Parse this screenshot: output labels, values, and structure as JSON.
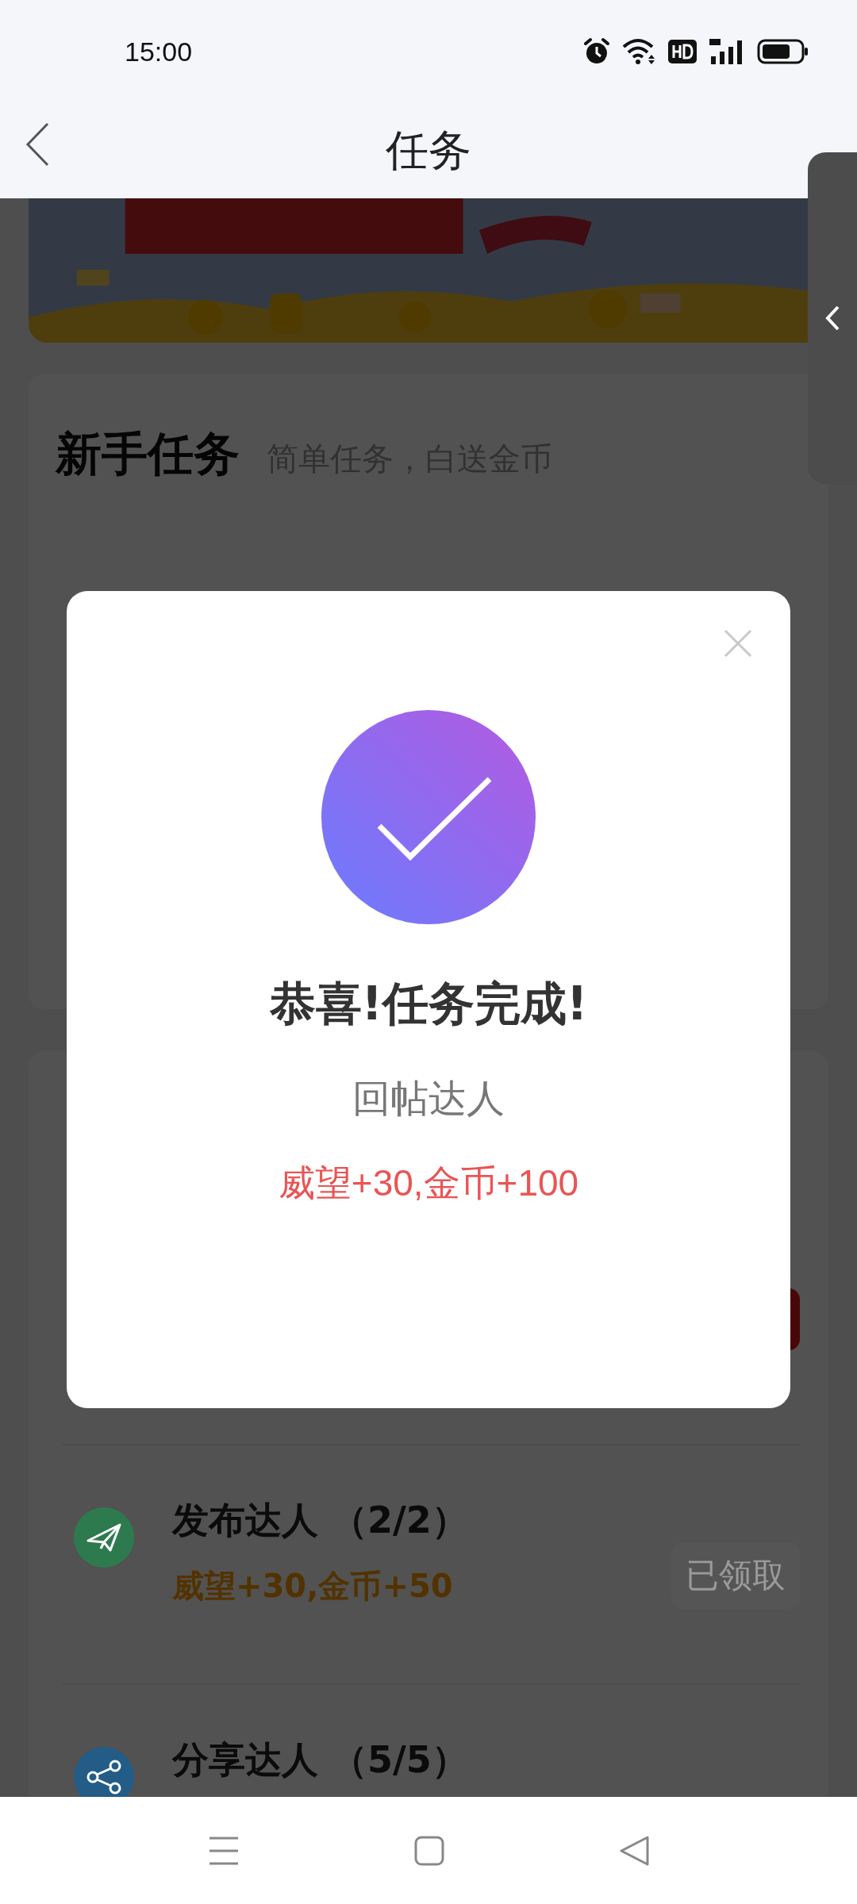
{
  "status_bar": {
    "time": "15:00"
  },
  "header": {
    "title": "任务"
  },
  "section": {
    "title": "新手任务",
    "subtitle": "简单任务，白送金币"
  },
  "tasks": [
    {
      "kind": "send",
      "title": "发布达人 （2/2）",
      "reward": "威望+30,金币+50",
      "button": "已领取",
      "claimed": true,
      "color": "#2e7a4f"
    },
    {
      "kind": "share",
      "title": "分享达人 （5/5）",
      "color": "#235c86"
    }
  ],
  "dialog": {
    "title": "恭喜!任务完成!",
    "task": "回帖达人",
    "reward": "威望+30,金币+100"
  }
}
